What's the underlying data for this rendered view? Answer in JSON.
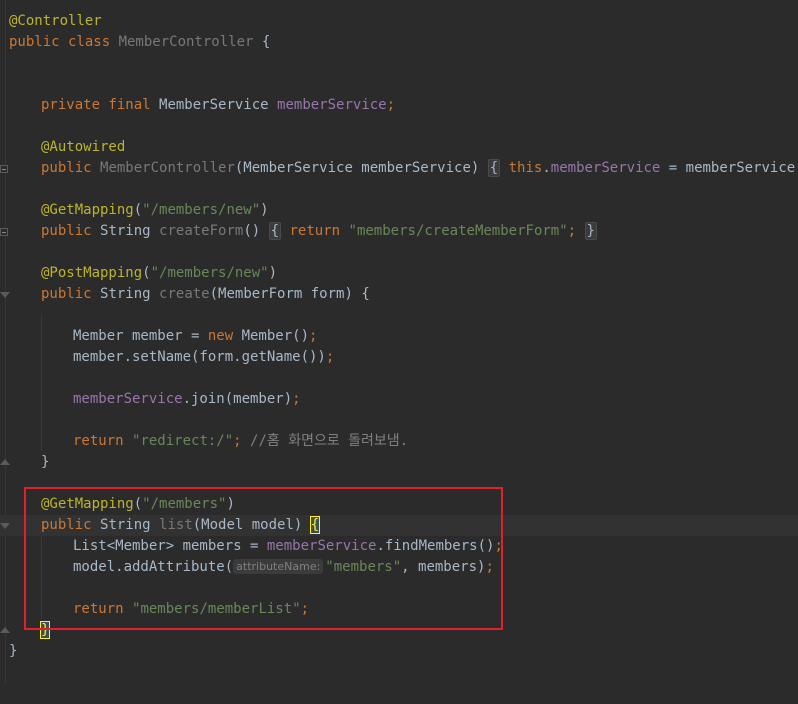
{
  "editor": {
    "language": "Java",
    "theme_colors": {
      "background": "#2b2b2b",
      "keyword": "#cc7832",
      "annotation": "#bbb529",
      "string": "#6a8759",
      "field": "#9876aa",
      "highlight_box": "#e0212a"
    },
    "lines": {
      "l1": {
        "ann": "@Controller"
      },
      "l2": {
        "kw": "public class ",
        "name": "MemberController",
        "rest": " {"
      },
      "l5": {
        "kw": "private final ",
        "type": "MemberService ",
        "field": "memberService",
        "semi": ";"
      },
      "l7": {
        "ann": "@Autowired"
      },
      "l8": {
        "kw": "public ",
        "name": "MemberController",
        "params": "(MemberService memberService)",
        "open": "{",
        "this": "this",
        "dot": ".",
        "field": "memberService",
        "assign": " = memberService",
        "semi": ";",
        "close": "}"
      },
      "l10": {
        "ann": "@GetMapping",
        "p1": "(",
        "str": "\"/members/new\"",
        "p2": ")"
      },
      "l11": {
        "kw": "public ",
        "type": "String ",
        "name": "createForm",
        "paren": "()",
        "open": "{",
        "ret": "return ",
        "str": "\"members/createMemberForm\"",
        "semi": ";",
        "close": "}"
      },
      "l13": {
        "ann": "@PostMapping",
        "p1": "(",
        "str": "\"/members/new\"",
        "p2": ")"
      },
      "l14": {
        "kw": "public ",
        "type": "String ",
        "name": "create",
        "rest": "(MemberForm form) {"
      },
      "l16": {
        "a": "Member member = ",
        "kw": "new ",
        "b": "Member()",
        "semi": ";"
      },
      "l17": {
        "a": "member.setName(form.getName())",
        "semi": ";"
      },
      "l19": {
        "field": "memberService",
        "a": ".join(member)",
        "semi": ";"
      },
      "l21": {
        "kw": "return ",
        "str": "\"redirect:/\"",
        "semi": "; ",
        "cmt": "//홈 화면으로 돌려보냄."
      },
      "l22": {
        "close": "}"
      },
      "l24": {
        "ann": "@GetMapping",
        "p1": "(",
        "str": "\"/members\"",
        "p2": ")"
      },
      "l25": {
        "kw": "public ",
        "type": "String ",
        "name": "list",
        "rest": "(Model model) ",
        "brace": "{"
      },
      "l26": {
        "a": "List<Member> members = ",
        "field": "memberService",
        "b": ".findMembers()",
        "semi": ";"
      },
      "l27": {
        "a": "model.addAttribute(",
        "hint": "attributeName:",
        "str": "\"members\"",
        "b": ", members)",
        "semi": ";"
      },
      "l29": {
        "kw": "return ",
        "str": "\"members/memberList\"",
        "semi": ";"
      },
      "l30": {
        "brace": "}"
      },
      "l31": {
        "close": "}"
      }
    }
  }
}
